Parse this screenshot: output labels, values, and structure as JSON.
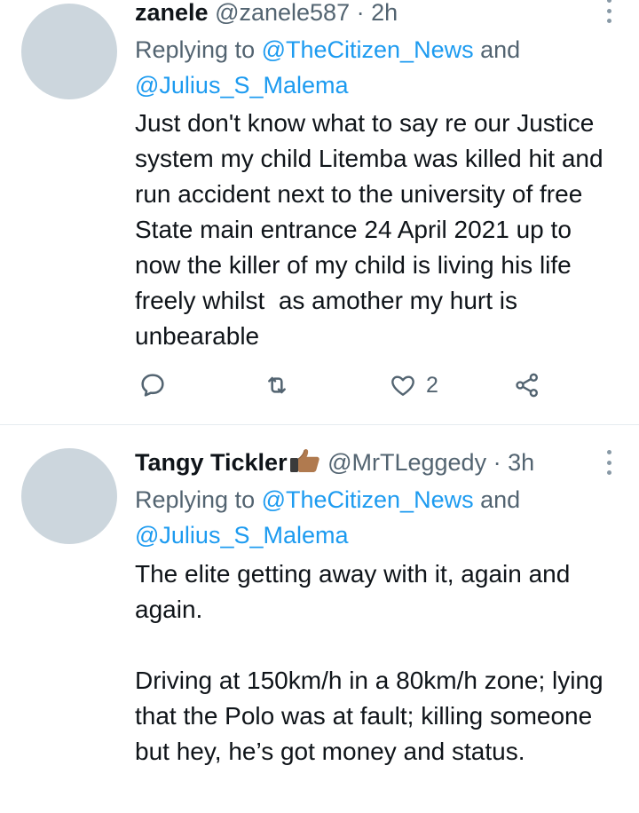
{
  "tweets": [
    {
      "name": "zanele",
      "handle": "@zanele587",
      "dot": "·",
      "time": "2h",
      "replying_prefix": "Replying to ",
      "mention1": "@TheCitizen_News",
      "and": " and",
      "mention2": "@Julius_S_Malema",
      "text": "Just don't know what to say re our Justice system my child Litemba was killed hit and run accident next to the university of free State main entrance 24 April 2021 up to now the killer of my child is living his life freely whilst  as amother my hurt is unbearable",
      "like_count": "2"
    },
    {
      "name": "Tangy Tickler",
      "emoji": "thumbs-up-emoji",
      "handle": "@MrTLeggedy",
      "dot": "·",
      "time": "3h",
      "replying_prefix": "Replying to ",
      "mention1": "@TheCitizen_News",
      "and": " and",
      "mention2": "@Julius_S_Malema",
      "text": "The elite getting away with it, again and again.\n\nDriving at 150km/h in a 80km/h zone; lying that the Polo was at fault; killing someone but hey, he’s got money and status."
    }
  ],
  "colors": {
    "link": "#1d9bf0",
    "secondary": "#536471",
    "avatar": "#ccd6dd"
  },
  "icons": [
    "reply-icon",
    "retweet-icon",
    "like-icon",
    "share-icon",
    "more-icon"
  ]
}
